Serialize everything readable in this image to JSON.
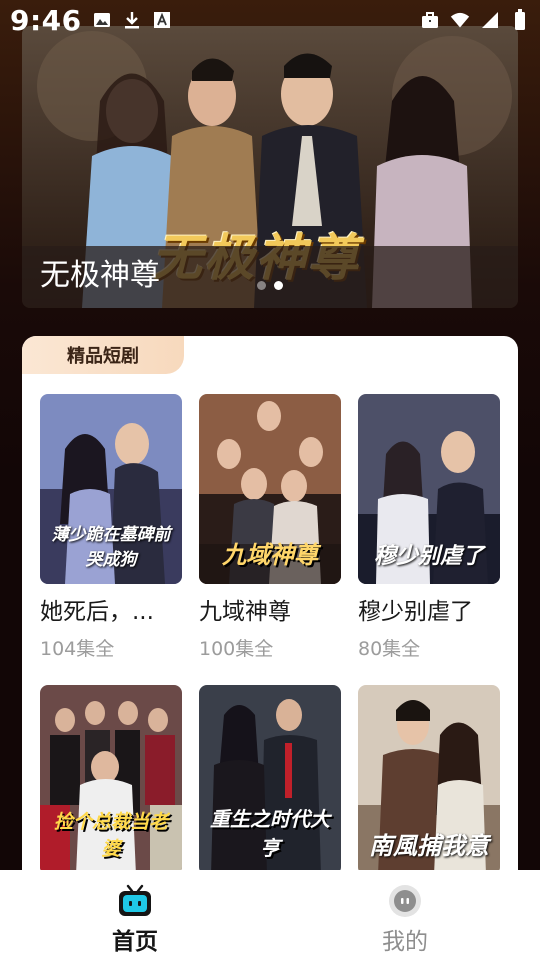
{
  "status_bar": {
    "time": "9:46",
    "left_icons": [
      "image-icon",
      "download-icon",
      "font-icon"
    ],
    "right_icons": [
      "briefcase-icon",
      "wifi-icon",
      "signal-icon",
      "battery-icon"
    ]
  },
  "banner": {
    "art_title": "无极神尊",
    "caption": "无极神尊",
    "page_count": 2,
    "active_page": 2
  },
  "section": {
    "tab_label": "精品短剧"
  },
  "dramas": [
    {
      "title": "她死后，...",
      "count": "104集全",
      "poster_text": "薄少跪在墓碑前哭成狗",
      "poster_colors": [
        "#6f7db5",
        "#2d2e4d"
      ]
    },
    {
      "title": "九域神尊",
      "count": "100集全",
      "poster_text": "九域神尊",
      "poster_colors": [
        "#8a5a44",
        "#2a1c18"
      ]
    },
    {
      "title": "穆少别虐了",
      "count": "80集全",
      "poster_text": "穆少别虐了",
      "poster_colors": [
        "#4a4d66",
        "#151726"
      ]
    },
    {
      "title": "",
      "count": "",
      "poster_text": "捡个总裁当老婆",
      "poster_colors": [
        "#5a3b3a",
        "#1e1212"
      ]
    },
    {
      "title": "",
      "count": "",
      "poster_text": "重生之时代大亨",
      "poster_colors": [
        "#3a3f4a",
        "#10131a"
      ]
    },
    {
      "title": "",
      "count": "",
      "poster_text": "南風捕我意",
      "poster_colors": [
        "#d6cabb",
        "#6b5a4a"
      ]
    }
  ],
  "bottom_nav": {
    "home_label": "首页",
    "mine_label": "我的",
    "colors": {
      "home_accent": "#1fc8e6",
      "inactive": "#8e8e8e"
    }
  }
}
